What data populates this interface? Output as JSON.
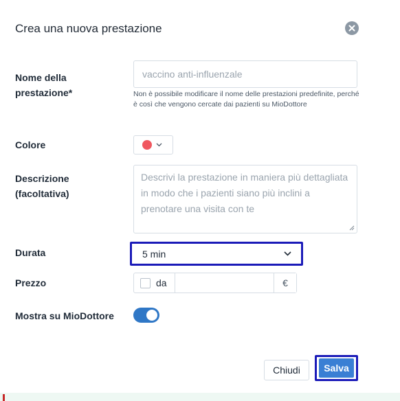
{
  "dialog": {
    "title": "Crea una nuova prestazione",
    "close_icon": "close-icon"
  },
  "form": {
    "name": {
      "label": "Nome della\nprestazione*",
      "placeholder": "vaccino anti-influenzale",
      "value": "",
      "helper": "Non è possibile modificare il nome delle prestazioni predefinite, perché è così che vengono cercate dai pazienti su MioDottore"
    },
    "color": {
      "label": "Colore",
      "selected_color": "#f0575f",
      "icon": "chevron-down-icon"
    },
    "description": {
      "label": "Descrizione\n(facoltativa)",
      "placeholder": "Descrivi la prestazione in maniera più dettagliata in modo che i pazienti siano più inclini a prenotare una visita con te",
      "value": ""
    },
    "duration": {
      "label": "Durata",
      "value": "5 min",
      "icon": "chevron-down-icon"
    },
    "price": {
      "label": "Prezzo",
      "from_label": "da",
      "from_checked": false,
      "value": "",
      "currency": "€"
    },
    "show_on": {
      "label": "Mostra su MioDottore",
      "enabled": true
    }
  },
  "actions": {
    "close_label": "Chiudi",
    "save_label": "Salva"
  },
  "colors": {
    "accent": "#3a7fd4",
    "toggle": "#2f77c6",
    "highlight_border": "#1a1ab8",
    "selected_color": "#f0575f"
  }
}
